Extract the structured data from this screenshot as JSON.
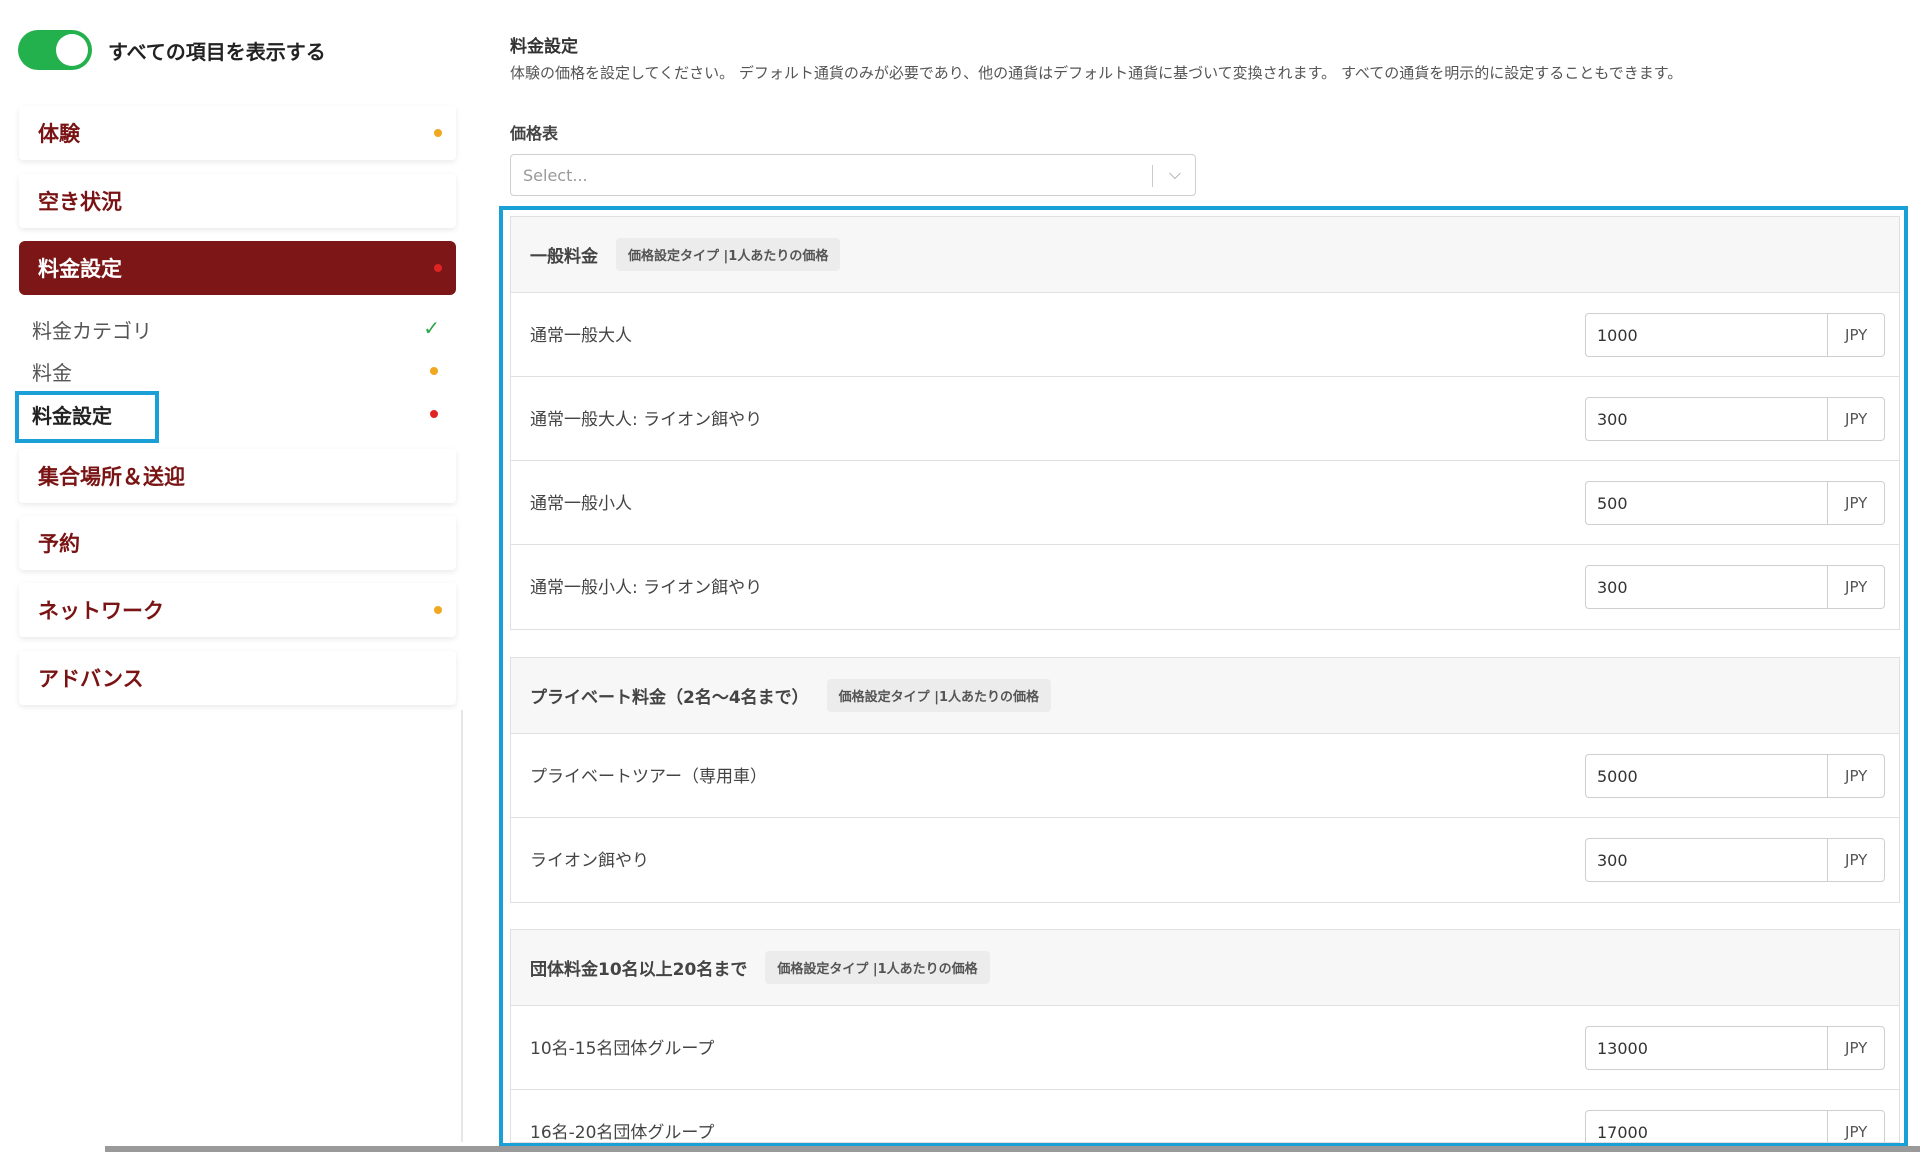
{
  "sidebar": {
    "toggle_label": "すべての項目を表示する",
    "items": [
      {
        "label": "体験",
        "dot": "orange"
      },
      {
        "label": "空き状況",
        "dot": ""
      },
      {
        "label": "料金設定",
        "dot": "red"
      },
      {
        "label": "集合場所＆送迎",
        "dot": ""
      },
      {
        "label": "予約",
        "dot": ""
      },
      {
        "label": "ネットワーク",
        "dot": "orange"
      },
      {
        "label": "アドバンス",
        "dot": ""
      }
    ],
    "sub_items": [
      {
        "label": "料金カテゴリ",
        "status": "check"
      },
      {
        "label": "料金",
        "status": "orange"
      },
      {
        "label": "料金設定",
        "status": "red"
      }
    ],
    "check_symbol": "✓"
  },
  "main": {
    "section_title": "料金設定",
    "section_desc": "体験の価格を設定してください。 デフォルト通貨のみが必要であり、他の通貨はデフォルト通貨に基づいて変換されます。 すべての通貨を明示的に設定することもできます。",
    "price_table_label": "価格表",
    "select_placeholder": "Select...",
    "currency": "JPY",
    "groups": [
      {
        "title": "一般料金",
        "badge": "価格設定タイプ |1人あたりの価格",
        "rows": [
          {
            "label": "通常一般大人",
            "value": "1000"
          },
          {
            "label": "通常一般大人: ライオン餌やり",
            "value": "300"
          },
          {
            "label": "通常一般小人",
            "value": "500"
          },
          {
            "label": "通常一般小人: ライオン餌やり",
            "value": "300"
          }
        ]
      },
      {
        "title": "プライベート料金（2名～4名まで）",
        "badge": "価格設定タイプ |1人あたりの価格",
        "rows": [
          {
            "label": "プライベートツアー（専用車）",
            "value": "5000"
          },
          {
            "label": "ライオン餌やり",
            "value": "300"
          }
        ]
      },
      {
        "title": "団体料金10名以上20名まで",
        "badge": "価格設定タイプ |1人あたりの価格",
        "rows": [
          {
            "label": "10名-15名団体グループ",
            "value": "13000"
          },
          {
            "label": "16名-20名団体グループ",
            "value": "17000"
          }
        ]
      }
    ]
  },
  "colors": {
    "accent": "#7d1616",
    "toggle_on": "#23b14d",
    "highlight": "#1a9fd6",
    "dot_orange": "#f0a820",
    "dot_red": "#e02424",
    "check_green": "#2aa84a"
  }
}
